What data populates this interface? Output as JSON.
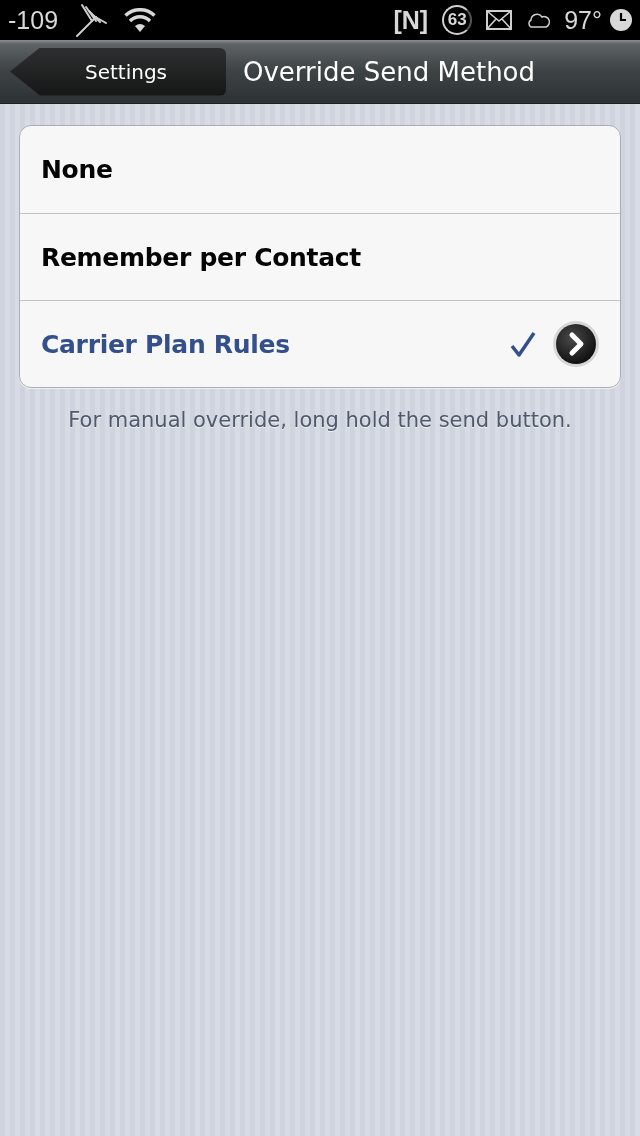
{
  "status_bar": {
    "signal_strength": "-109",
    "notification_badge": "[N]",
    "battery_percent": "63",
    "temperature": "97°"
  },
  "nav_bar": {
    "back_button": "Settings",
    "title": "Override Send Method"
  },
  "options": [
    {
      "label": "None",
      "selected": false,
      "has_detail": false
    },
    {
      "label": "Remember per Contact",
      "selected": false,
      "has_detail": false
    },
    {
      "label": "Carrier Plan Rules",
      "selected": true,
      "has_detail": true
    }
  ],
  "footer": "For manual override, long hold the send button."
}
